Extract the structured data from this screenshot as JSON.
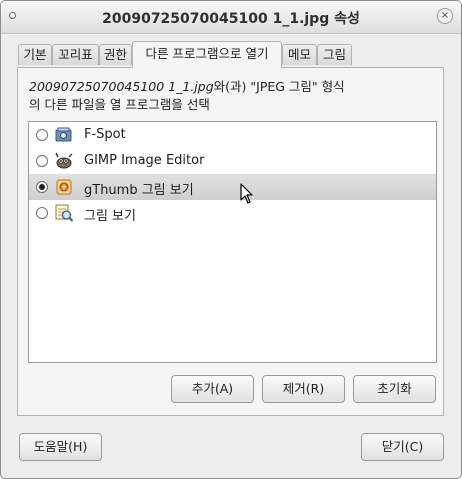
{
  "window": {
    "title": "20090725070045100 1_1.jpg 속성"
  },
  "tabs": [
    {
      "label": "기본"
    },
    {
      "label": "꼬리표"
    },
    {
      "label": "권한"
    },
    {
      "label": "다른 프로그램으로 열기"
    },
    {
      "label": "메모"
    },
    {
      "label": "그림"
    }
  ],
  "open_with": {
    "filename": "20090725070045100 1_1.jpg",
    "desc_part1": "와(과) \"JPEG 그림\" 형식",
    "desc_line2": "의 다른 파일을 열 프로그램을 선택",
    "apps": [
      {
        "label": "F-Spot",
        "icon": "f-spot-icon",
        "selected": false
      },
      {
        "label": "GIMP Image Editor",
        "icon": "gimp-icon",
        "selected": false
      },
      {
        "label": "gThumb 그림 보기",
        "icon": "gthumb-icon",
        "selected": true
      },
      {
        "label": "그림 보기",
        "icon": "image-viewer-icon",
        "selected": false
      }
    ],
    "add_button": "추가(A)",
    "remove_button": "제거(R)",
    "reset_button": "초기화"
  },
  "footer": {
    "help_button": "도움말(H)",
    "close_button": "닫기(C)"
  }
}
